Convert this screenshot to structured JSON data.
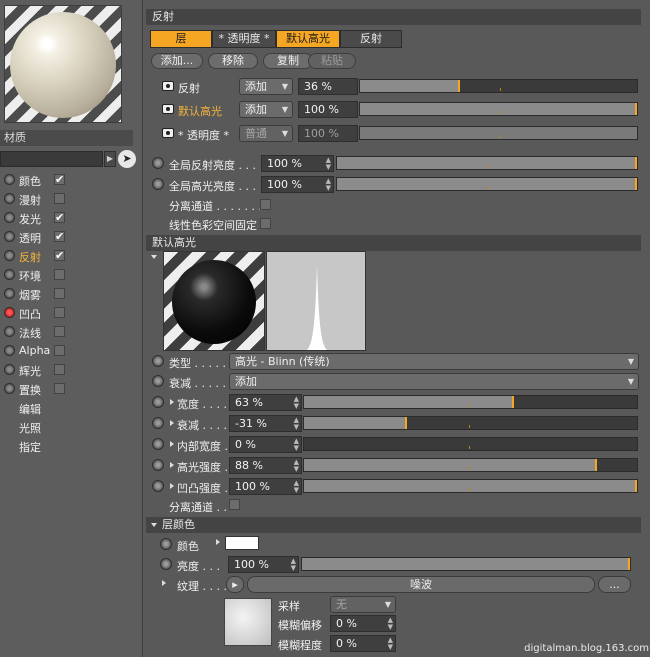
{
  "sidebar": {
    "section_label": "材质",
    "channels": [
      {
        "label": "颜色",
        "checked": true
      },
      {
        "label": "漫射",
        "checked": false
      },
      {
        "label": "发光",
        "checked": true
      },
      {
        "label": "透明",
        "checked": true
      },
      {
        "label": "反射",
        "checked": true,
        "selected": true
      },
      {
        "label": "环境",
        "checked": false
      },
      {
        "label": "烟雾",
        "checked": false
      },
      {
        "label": "凹凸",
        "checked": false,
        "red": true
      },
      {
        "label": "法线",
        "checked": false
      },
      {
        "label": "Alpha",
        "checked": false
      },
      {
        "label": "辉光",
        "checked": false
      },
      {
        "label": "置换",
        "checked": false
      }
    ],
    "extra_items": [
      "编辑",
      "光照",
      "指定"
    ],
    "check_mark": "✔"
  },
  "panel": {
    "title": "反射",
    "tabs": [
      "层",
      "* 透明度 *",
      "默认高光",
      "反射"
    ],
    "buttons": [
      "添加...",
      "移除",
      "复制",
      "粘贴"
    ],
    "layers": [
      {
        "name": "反射",
        "mode": "添加",
        "value": "36 %",
        "fraction": 0.36
      },
      {
        "name": "默认高光",
        "mode": "添加",
        "value": "100 %",
        "fraction": 1.0
      },
      {
        "name": "* 透明度 *",
        "mode": "普通",
        "value": "100 %",
        "fraction": 1.0
      }
    ],
    "global_reflection_label": "全局反射亮度 . . .",
    "global_reflection_value": "100 %",
    "global_specular_label": "全局高光亮度 . . .",
    "global_specular_value": "100 %",
    "separate_pass_label": "分离通道 . . . . . . .",
    "linear_color_label": "线性色彩空间固定"
  },
  "specular": {
    "header": "默认高光",
    "type_label": "类型 . . . . . .",
    "type_value": "高光 - Blinn (传统)",
    "falloff_label": "衰减 . . . . .",
    "falloff_value": "添加",
    "params": [
      {
        "label": "宽度 . . . . . . .",
        "value": "63 %",
        "fraction": 0.63
      },
      {
        "label": "衰减 . . . . . . .",
        "value": "-31 %",
        "fraction": 0.31
      },
      {
        "label": "内部宽度 . . . .",
        "value": "0 %",
        "fraction": 0.0
      },
      {
        "label": "高光强度 . . . .",
        "value": "88 %",
        "fraction": 0.88
      },
      {
        "label": "凹凸强度 . . . .",
        "value": "100 %",
        "fraction": 1.0
      }
    ],
    "separate_pass_label": "分离通道 . ."
  },
  "layer_color": {
    "header": "层颜色",
    "color_label": "颜色",
    "color_value": "#ffffff",
    "brightness_label": "亮度 . . .",
    "brightness_value": "100 %",
    "brightness_fraction": 1.0,
    "texture_label": "纹理 . . . .",
    "texture_name": "噪波",
    "more_button": "...",
    "sampling_label": "采样",
    "sampling_value": "无",
    "blur_offset_label": "模糊偏移",
    "blur_offset_value": "0 %",
    "blur_scale_label": "模糊程度",
    "blur_scale_value": "0 %"
  },
  "watermark": "digitalman.blog.163.com",
  "colors": {
    "accent": "#f5a623",
    "panel": "#595959",
    "header": "#444444"
  }
}
